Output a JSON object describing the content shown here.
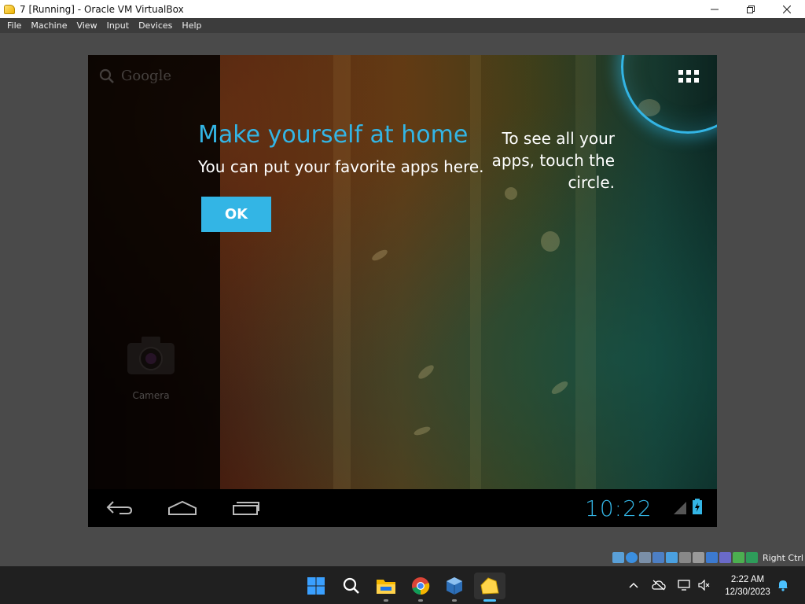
{
  "window": {
    "title": "7 [Running] - Oracle VM VirtualBox",
    "icon": "virtualbox-app-icon",
    "controls": [
      "minimize-icon",
      "restore-icon",
      "close-icon"
    ]
  },
  "menubar": {
    "items": [
      "File",
      "Machine",
      "View",
      "Input",
      "Devices",
      "Help"
    ]
  },
  "guest": {
    "search_label": "Google",
    "apps_button_icon": "all-apps-grid-icon",
    "shortcut": {
      "label": "Camera",
      "icon": "camera-icon"
    },
    "cling": {
      "title": "Make yourself at home",
      "subtitle": "You can put your favorite apps here.",
      "ok_label": "OK",
      "all_apps_hint": "To see all your apps, touch the circle."
    },
    "navbar": {
      "buttons": [
        "back-icon",
        "home-icon",
        "recent-apps-icon"
      ],
      "clock": "10:22",
      "status_icons": [
        "signal-icon",
        "battery-icon"
      ]
    }
  },
  "vbox_status": {
    "icons": [
      "hard-disk-icon",
      "optical-disk-icon",
      "audio-icon",
      "network-icon",
      "usb-icon",
      "shared-folders-icon",
      "display-icon",
      "video-capture-icon",
      "vrde-icon",
      "mouse-integration-icon",
      "keyboard-icon"
    ],
    "host_key": "Right Ctrl"
  },
  "taskbar": {
    "apps": [
      "windows-start-icon",
      "search-icon",
      "file-explorer-icon",
      "chrome-icon",
      "virtualbox-icon",
      "virtualbox-vm-icon"
    ],
    "tray_icons": [
      "chevron-up-icon",
      "network-disconnected-icon",
      "display-icon",
      "volume-muted-icon"
    ],
    "time": "2:22 AM",
    "date": "12/30/2023",
    "notification_icon": "bell-icon"
  },
  "colors": {
    "android_accent": "#33b5e5",
    "menubar_bg": "#3c3c3c",
    "host_bg": "#4a4a4a",
    "taskbar_bg": "#202020"
  }
}
